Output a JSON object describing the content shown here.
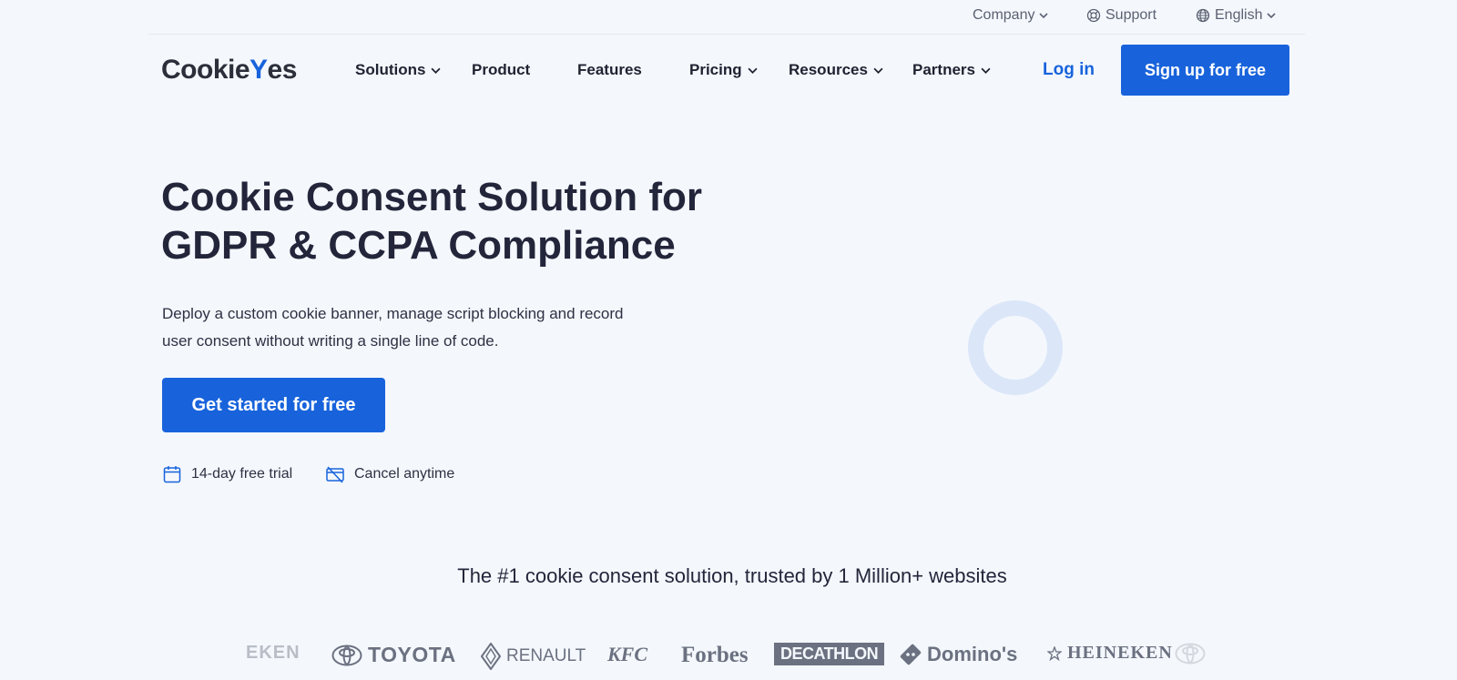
{
  "utility_bar": {
    "company": "Company",
    "support": "Support",
    "language": "English"
  },
  "logo": {
    "text_before": "Cookie",
    "text_check": "Y",
    "text_after": "es"
  },
  "nav": {
    "solutions": "Solutions",
    "product": "Product",
    "features": "Features",
    "pricing": "Pricing",
    "resources": "Resources",
    "partners": "Partners",
    "login": "Log in",
    "signup": "Sign up for free"
  },
  "hero": {
    "title_line1": "Cookie Consent Solution for",
    "title_line2": "GDPR & CCPA Compliance",
    "desc_line1": "Deploy a custom cookie banner, manage script blocking and record",
    "desc_line2": "user consent without writing a single line of code.",
    "cta": "Get started for free",
    "perk_trial": "14-day free trial",
    "perk_cancel": "Cancel anytime"
  },
  "trust": {
    "headline": "The #1 cookie consent solution, trusted by 1 Million+ websites",
    "brands": {
      "heineken_left": "EKEN",
      "toyota": "TOYOTA",
      "renault": "RENAULT",
      "kfc": "KFC",
      "forbes": "Forbes",
      "decathlon": "DECATHLON",
      "dominos": "Domino's",
      "heineken_right": "HEINEKEN"
    }
  },
  "colors": {
    "accent": "#1863dc",
    "background": "#f4f8fd",
    "text": "#23263a"
  }
}
